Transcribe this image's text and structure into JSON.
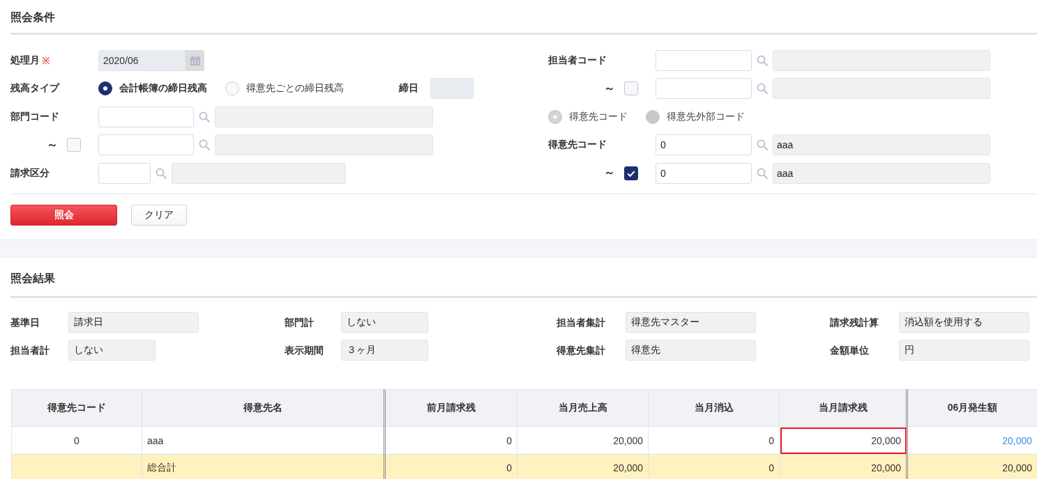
{
  "query": {
    "title": "照会条件",
    "processing_month": {
      "label": "処理月",
      "required_mark": "※",
      "value": "2020/06"
    },
    "balance_type": {
      "label": "残高タイプ",
      "options": [
        {
          "label": "会計帳簿の締日残高",
          "selected": true,
          "disabled": false
        },
        {
          "label": "得意先ごとの締日残高",
          "selected": false,
          "disabled": false
        }
      ],
      "closing_day_label": "締日"
    },
    "department": {
      "label": "部門コード",
      "range_mark": "～",
      "range_checked": false
    },
    "billing_class": {
      "label": "請求区分"
    },
    "staff": {
      "label": "担当者コード",
      "range_mark": "～",
      "range_checked": false
    },
    "customer_code_type": {
      "options": [
        {
          "label": "得意先コード",
          "selected": true,
          "disabled": true
        },
        {
          "label": "得意先外部コード",
          "selected": false,
          "disabled": true
        }
      ]
    },
    "customer": {
      "label": "得意先コード",
      "from": {
        "code": "0",
        "name": "aaa"
      },
      "range_mark": "～",
      "range_checked": true,
      "to": {
        "code": "0",
        "name": "aaa"
      }
    },
    "buttons": [
      {
        "label": "照会",
        "kind": "primary"
      },
      {
        "label": "クリア",
        "kind": "secondary"
      }
    ]
  },
  "results": {
    "title": "照会結果",
    "settings": [
      {
        "label": "基準日",
        "value": "請求日"
      },
      {
        "label": "部門計",
        "value": "しない"
      },
      {
        "label": "担当者集計",
        "value": "得意先マスター"
      },
      {
        "label": "請求残計算",
        "value": "消込額を使用する"
      },
      {
        "label": "担当者計",
        "value": "しない"
      },
      {
        "label": "表示期間",
        "value": "３ヶ月"
      },
      {
        "label": "得意先集計",
        "value": "得意先"
      },
      {
        "label": "金額単位",
        "value": "円"
      }
    ],
    "table": {
      "columns": [
        {
          "label": "得意先コード",
          "kind": "code",
          "divider": false
        },
        {
          "label": "得意先名",
          "kind": "name",
          "divider": true
        },
        {
          "label": "前月請求残",
          "kind": "amount",
          "divider": false
        },
        {
          "label": "当月売上高",
          "kind": "amount",
          "divider": false
        },
        {
          "label": "当月消込",
          "kind": "amount",
          "divider": false
        },
        {
          "label": "当月請求残",
          "kind": "amount",
          "divider": true
        },
        {
          "label": "06月発生額",
          "kind": "amount",
          "divider": false
        }
      ],
      "rows": [
        {
          "kind": "data",
          "cells": [
            {
              "text": "0",
              "selected": false,
              "link": false
            },
            {
              "text": "aaa",
              "selected": false,
              "link": false
            },
            {
              "text": "0",
              "selected": false,
              "link": false
            },
            {
              "text": "20,000",
              "selected": false,
              "link": false
            },
            {
              "text": "0",
              "selected": false,
              "link": false
            },
            {
              "text": "20,000",
              "selected": true,
              "link": false
            },
            {
              "text": "20,000",
              "selected": false,
              "link": true
            }
          ]
        },
        {
          "kind": "total",
          "cells": [
            {
              "selected": false
            },
            {
              "text": "総合計",
              "selected": false,
              "link": false
            },
            {
              "text": "0",
              "selected": false,
              "link": false
            },
            {
              "text": "20,000",
              "selected": false,
              "link": false
            },
            {
              "text": "0",
              "selected": false,
              "link": false
            },
            {
              "text": "20,000",
              "selected": false,
              "link": false
            },
            {
              "text": "20,000",
              "selected": false,
              "link": false
            }
          ]
        }
      ]
    }
  }
}
